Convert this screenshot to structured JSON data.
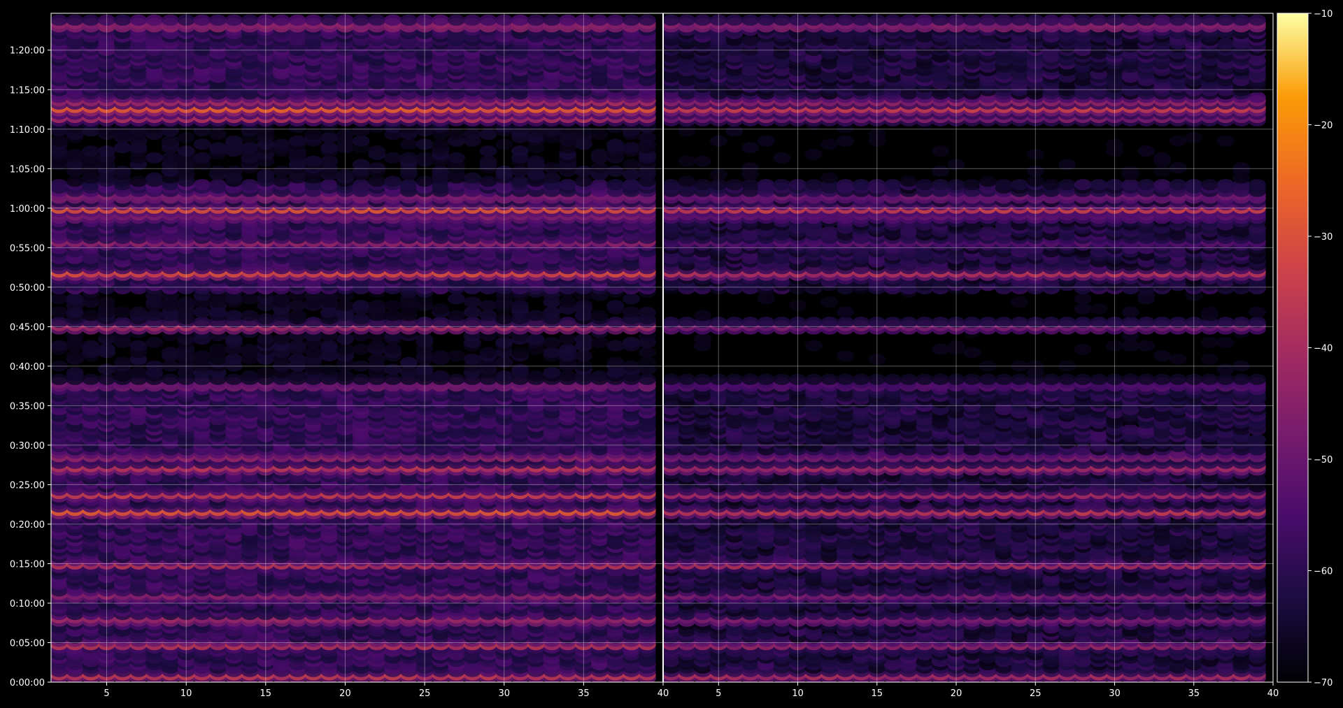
{
  "chart_data": {
    "type": "heatmap",
    "description_mode": "dot-matrix heatmap of two panels sharing a time axis",
    "panels": [
      {
        "name": "",
        "x_range": [
          1.5,
          40
        ],
        "x_ticks": [
          5,
          10,
          15,
          20,
          25,
          30,
          35,
          40
        ]
      },
      {
        "name": "",
        "x_range": [
          1.5,
          40
        ],
        "x_ticks": [
          5,
          10,
          15,
          20,
          25,
          30,
          35,
          40
        ]
      }
    ],
    "x_columns": {
      "start": 2,
      "end": 39,
      "step": 1
    },
    "y_axis": {
      "range_seconds": [
        0,
        5080
      ],
      "tick_labels": [
        "0:00:00",
        "0:05:00",
        "0:10:00",
        "0:15:00",
        "0:20:00",
        "0:25:00",
        "0:30:00",
        "0:35:00",
        "0:40:00",
        "0:45:00",
        "0:50:00",
        "0:55:00",
        "1:00:00",
        "1:05:00",
        "1:10:00",
        "1:15:00",
        "1:20:00"
      ],
      "tick_step_seconds": 300,
      "row_step_seconds": 102
    },
    "colorbar": {
      "colormap": "inferno",
      "range": [
        -70,
        -10
      ],
      "tick_values": [
        -10,
        -20,
        -30,
        -40,
        -50,
        -60,
        -70
      ],
      "tick_labels": [
        "−10",
        "−20",
        "−30",
        "−40",
        "−50",
        "−60",
        "−70"
      ]
    },
    "bright_bands_seconds": [
      {
        "t": 4360,
        "left": -22,
        "right": -30
      },
      {
        "t": 4420,
        "left": -38,
        "right": -42
      },
      {
        "t": 4290,
        "left": -38,
        "right": -46
      },
      {
        "t": 4990,
        "left": -36,
        "right": -38
      },
      {
        "t": 5060,
        "left": -38,
        "right": -40
      },
      {
        "t": 3600,
        "left": -30,
        "right": -34
      },
      {
        "t": 3690,
        "left": -40,
        "right": -44
      },
      {
        "t": 3540,
        "left": -42,
        "right": -48
      },
      {
        "t": 3340,
        "left": -42,
        "right": -52
      },
      {
        "t": 3110,
        "left": -26,
        "right": -34
      },
      {
        "t": 2700,
        "left": -36,
        "right": -44
      },
      {
        "t": 2260,
        "left": -42,
        "right": -50
      },
      {
        "t": 1630,
        "left": -32,
        "right": -36
      },
      {
        "t": 1720,
        "left": -40,
        "right": -44
      },
      {
        "t": 1300,
        "left": -24,
        "right": -32
      },
      {
        "t": 1430,
        "left": -32,
        "right": -40
      },
      {
        "t": 900,
        "left": -36,
        "right": -38
      },
      {
        "t": 660,
        "left": -40,
        "right": -44
      },
      {
        "t": 480,
        "left": -36,
        "right": -42
      },
      {
        "t": 290,
        "left": -34,
        "right": -40
      },
      {
        "t": 50,
        "left": -32,
        "right": -36
      }
    ],
    "colors": {
      "background": "#000000",
      "grid": "#ffffff",
      "frame": "#ffffff",
      "text": "#ffffff"
    }
  }
}
